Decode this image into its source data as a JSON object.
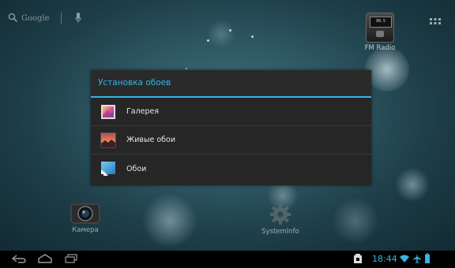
{
  "home": {
    "search_label": "Google",
    "apps": [
      {
        "label": "FM Radio",
        "display": "90.5"
      },
      {
        "label": "Камера"
      },
      {
        "label": "SystemInfo"
      }
    ]
  },
  "dialog": {
    "title": "Установка обоев",
    "items": [
      {
        "label": "Галерея",
        "icon": "gallery-icon"
      },
      {
        "label": "Живые обои",
        "icon": "live-wallpaper-icon"
      },
      {
        "label": "Обои",
        "icon": "wallpaper-icon"
      }
    ]
  },
  "statusbar": {
    "time": "18:44"
  },
  "colors": {
    "accent": "#33b5e5",
    "dialog_bg": "#262626"
  }
}
